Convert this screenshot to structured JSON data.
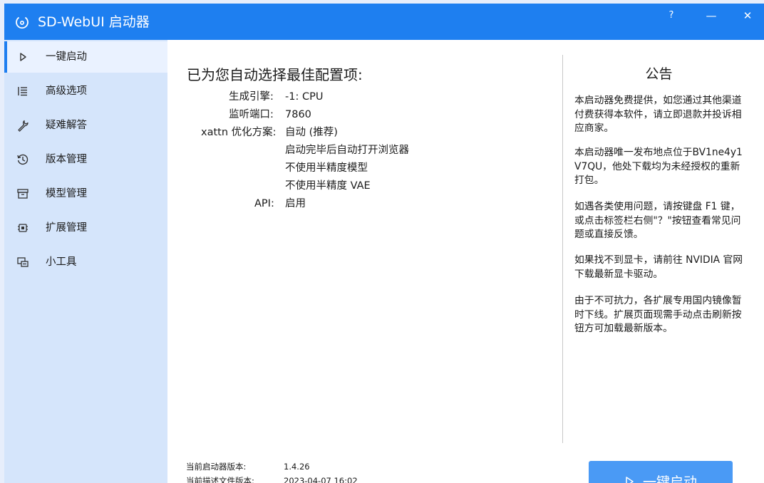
{
  "window": {
    "title": "SD-WebUI 启动器",
    "controls": {
      "help": "?",
      "minimize": "—",
      "close": "✕"
    }
  },
  "colors": {
    "accent": "#1e7ff0",
    "sidebar": "#d5e5fb",
    "button": "#4a9af5"
  },
  "sidebar": {
    "items": [
      {
        "label": "一键启动",
        "icon": "play-icon"
      },
      {
        "label": "高级选项",
        "icon": "list-icon"
      },
      {
        "label": "疑难解答",
        "icon": "wrench-icon"
      },
      {
        "label": "版本管理",
        "icon": "history-icon"
      },
      {
        "label": "模型管理",
        "icon": "archive-icon"
      },
      {
        "label": "扩展管理",
        "icon": "chip-icon"
      },
      {
        "label": "小工具",
        "icon": "toolbox-icon"
      }
    ],
    "active_index": 0
  },
  "main": {
    "title": "已为您自动选择最佳配置项:",
    "config": [
      {
        "label": "生成引擎:",
        "values": [
          "-1: CPU"
        ]
      },
      {
        "label": "监听端口:",
        "values": [
          "7860"
        ]
      },
      {
        "label": "xattn 优化方案:",
        "values": [
          "自动 (推荐)",
          "启动完毕后自动打开浏览器",
          "不使用半精度模型",
          "不使用半精度 VAE"
        ]
      },
      {
        "label": "API:",
        "values": [
          "启用"
        ]
      }
    ]
  },
  "notice": {
    "title": "公告",
    "paragraphs": [
      "本启动器免费提供，如您通过其他渠道付费获得本软件，请立即退款并投诉相应商家。",
      "本启动器唯一发布地点位于BV1ne4y1V7QU，他处下载均为未经授权的重新打包。",
      "如遇各类使用问题，请按键盘 F1 键，或点击标签栏右侧\"？\"按钮查看常见问题或直接反馈。",
      "如果找不到显卡，请前往 NVIDIA 官网下载最新显卡驱动。",
      "由于不可抗力，各扩展专用国内镜像暂时下线。扩展页面现需手动点击刷新按钮方可加载最新版本。"
    ]
  },
  "footer": {
    "launcher_version_label": "当前启动器版本:",
    "launcher_version": "1.4.26",
    "desc_version_label": "当前描述文件版本:",
    "desc_version": "2023-04-07 16:02"
  },
  "launch_button": {
    "label": "一键启动",
    "icon": "play-icon"
  }
}
